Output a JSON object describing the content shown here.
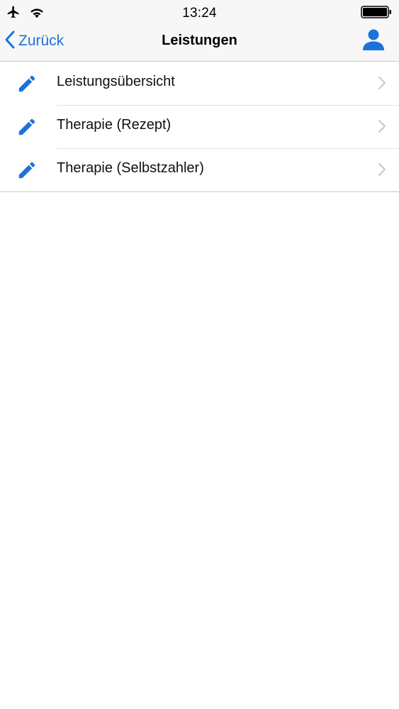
{
  "status_bar": {
    "time": "13:24",
    "airplane_icon": "airplane-icon",
    "wifi_icon": "wifi-icon",
    "battery_icon": "battery-icon"
  },
  "nav": {
    "back_label": "Zurück",
    "title": "Leistungen",
    "profile_icon": "person-icon"
  },
  "colors": {
    "accent": "#1a73d9",
    "bar_background": "#f7f7f8",
    "separator": "#c8c8cc",
    "chevron": "#c7c7cc"
  },
  "list": {
    "items": [
      {
        "label": "Leistungsübersicht",
        "icon": "pencil-icon"
      },
      {
        "label": "Therapie (Rezept)",
        "icon": "pencil-icon"
      },
      {
        "label": "Therapie (Selbstzahler)",
        "icon": "pencil-icon"
      }
    ]
  }
}
